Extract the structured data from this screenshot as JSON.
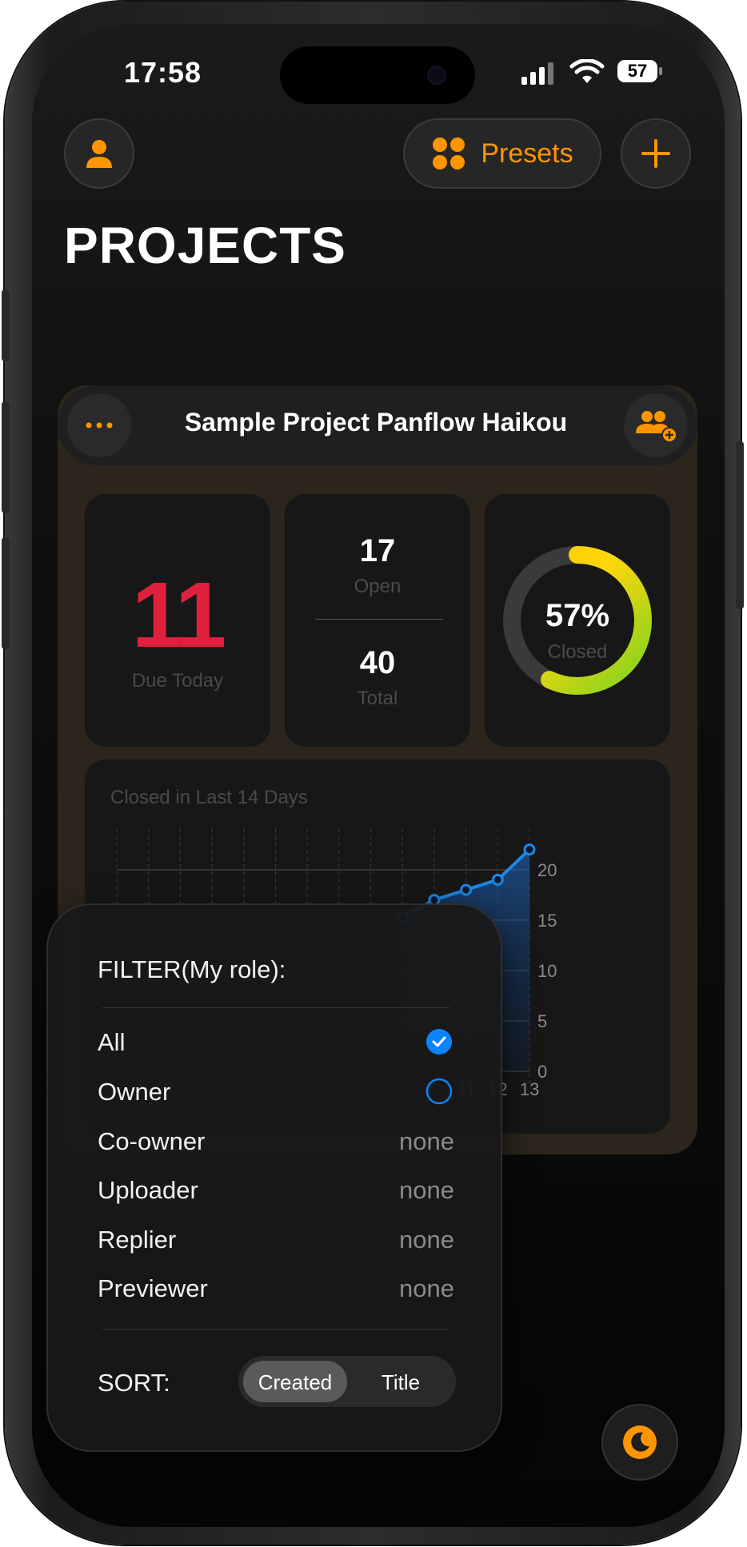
{
  "status_bar": {
    "time": "17:58",
    "battery": "57"
  },
  "header": {
    "presets_label": "Presets",
    "title": "PROJECTS"
  },
  "project": {
    "name": "Sample Project Panflow Haikou",
    "due_today": "11",
    "due_today_label": "Due Today",
    "open": "17",
    "open_label": "Open",
    "total": "40",
    "total_label": "Total",
    "closed_percent": "57%",
    "closed_label": "Closed",
    "closed_fraction": 0.57
  },
  "chart_data": {
    "type": "area",
    "title": "Closed in Last 14 Days",
    "x_ticks_visible": [
      "11",
      "12",
      "13"
    ],
    "y_ticks": [
      "0",
      "5",
      "10",
      "15",
      "20"
    ],
    "ylim": [
      0,
      23
    ],
    "points": [
      {
        "x": 9,
        "y": 15.3
      },
      {
        "x": 10,
        "y": 17
      },
      {
        "x": 11,
        "y": 18
      },
      {
        "x": 12,
        "y": 19
      },
      {
        "x": 13,
        "y": 22
      }
    ],
    "grid": true
  },
  "filter": {
    "title": "FILTER(My role):",
    "rows": [
      {
        "label": "All",
        "state": "checked"
      },
      {
        "label": "Owner",
        "state": "unchecked"
      },
      {
        "label": "Co-owner",
        "value": "none"
      },
      {
        "label": "Uploader",
        "value": "none"
      },
      {
        "label": "Replier",
        "value": "none"
      },
      {
        "label": "Previewer",
        "value": "none"
      }
    ]
  },
  "sort": {
    "label": "SORT:",
    "options": [
      "Created",
      "Title"
    ],
    "selected": "Created"
  },
  "colors": {
    "accent": "#ff9500",
    "due": "#e0203c",
    "chart_line": "#1e88e5",
    "check": "#0a84ff"
  }
}
